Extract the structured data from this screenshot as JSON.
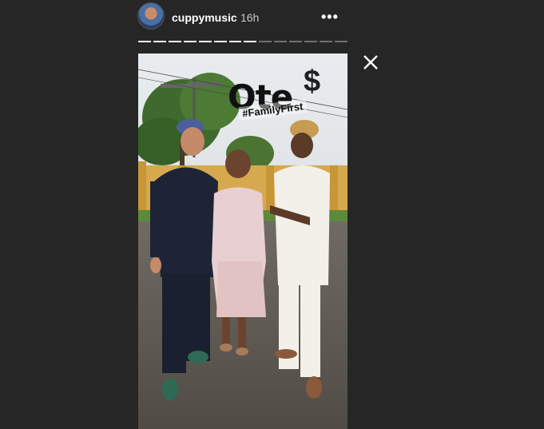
{
  "header": {
    "username": "cuppymusic",
    "timestamp": "16h",
    "more_label": "•••"
  },
  "progress": {
    "segments": 14,
    "completed": 8
  },
  "story": {
    "sticker_text": "Ote",
    "sticker_symbol": "$",
    "hashtag": "#FamilyFirst"
  },
  "icons": [
    "avatar",
    "more-options-icon",
    "close-icon"
  ],
  "colors": {
    "background": "#262626",
    "text": "#ffffff",
    "muted": "#c7c7c7"
  }
}
